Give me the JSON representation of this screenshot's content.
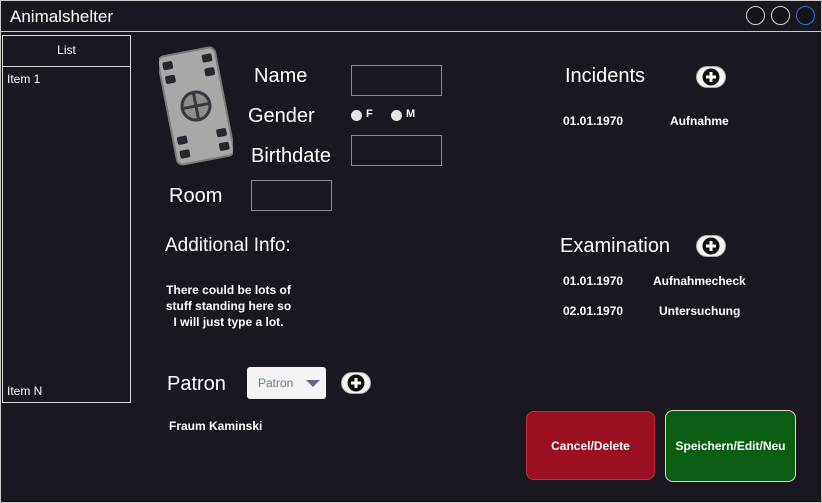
{
  "window": {
    "title": "Animalshelter"
  },
  "list": {
    "header": "List",
    "items": [
      "Item 1",
      "Item N"
    ]
  },
  "form": {
    "name_label": "Name",
    "gender_label": "Gender",
    "gender_options": [
      "F",
      "M"
    ],
    "birthdate_label": "Birthdate",
    "room_label": "Room",
    "name_value": "",
    "birthdate_value": "",
    "room_value": ""
  },
  "additional": {
    "label": "Additional Info:",
    "lines": [
      "There could be lots of",
      "stuff standing here so",
      "I will just type a lot."
    ]
  },
  "patron": {
    "label": "Patron",
    "select_value": "Patron",
    "name": "Fraum Kaminski"
  },
  "incidents": {
    "title": "Incidents",
    "rows": [
      {
        "date": "01.01.1970",
        "desc": "Aufnahme"
      }
    ]
  },
  "examination": {
    "title": "Examination",
    "rows": [
      {
        "date": "01.01.1970",
        "desc": "Aufnahmecheck"
      },
      {
        "date": "02.01.1970",
        "desc": "Untersuchung"
      }
    ]
  },
  "actions": {
    "cancel": "Cancel/Delete",
    "save": "Speichern/Edit/Neu"
  },
  "colors": {
    "background": "#1b1720",
    "cancel": "#9a0f22",
    "save": "#0a5e12",
    "close_ring": "#2a78d6"
  },
  "icons": {
    "photo": "film-reel-icon",
    "add": "plus-icon",
    "dropdown": "chevron-down-icon"
  }
}
